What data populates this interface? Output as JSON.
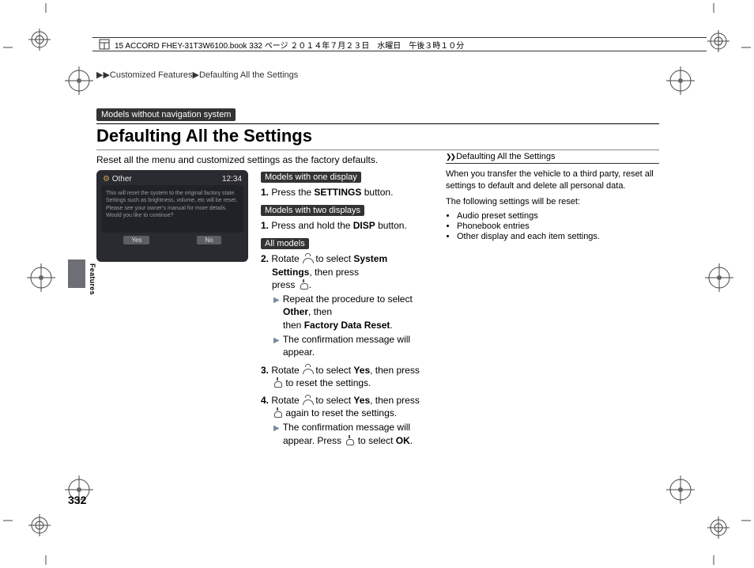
{
  "bookline": "15 ACCORD FHEY-31T3W6100.book  332 ページ  ２０１４年７月２３日　水曜日　午後３時１０分",
  "breadcrumb": {
    "part1": "Customized Features",
    "part2": "Defaulting All the Settings"
  },
  "section_tag": "Models without navigation system",
  "title": "Defaulting All the Settings",
  "intro": "Reset all the menu and customized settings as the factory defaults.",
  "screenshot": {
    "tab": "Other",
    "clock": "12:34",
    "msg": "This will reset the system to the original factory state. Settings such as brightness, volume, etc will be reset. Please see your owner's manual for more details. Would you like to continue?",
    "yes": "Yes",
    "no": "No"
  },
  "mid": {
    "tag_one": "Models with one display",
    "step1a_num": "1.",
    "step1a_a": "Press the ",
    "step1a_b": "SETTINGS",
    "step1a_c": " button.",
    "tag_two": "Models with two displays",
    "step1b_num": "1.",
    "step1b_a": "Press and hold the ",
    "step1b_b": "DISP",
    "step1b_c": " button.",
    "tag_all": "All models",
    "step2_num": "2.",
    "step2_a": "Rotate ",
    "step2_b": " to select ",
    "step2_c": "System Settings",
    "step2_d": ", then press ",
    "step2_e": ".",
    "step2_sub1_a": "Repeat the procedure to select ",
    "step2_sub1_b": "Other",
    "step2_sub1_c": ", then ",
    "step2_sub1_d": "Factory Data Reset",
    "step2_sub1_e": ".",
    "step2_sub2": "The confirmation message will appear.",
    "step3_num": "3.",
    "step3_a": "Rotate ",
    "step3_b": " to select ",
    "step3_c": "Yes",
    "step3_d": ", then press ",
    "step3_e": " to reset the settings.",
    "step4_num": "4.",
    "step4_a": "Rotate ",
    "step4_b": " to select ",
    "step4_c": "Yes",
    "step4_d": ", then press ",
    "step4_e": " again to reset the settings.",
    "step4_sub_a": "The confirmation message will appear. Press ",
    "step4_sub_b": " to select ",
    "step4_sub_c": "OK",
    "step4_sub_d": "."
  },
  "right": {
    "header": "Defaulting All the Settings",
    "p1": "When you transfer the vehicle to a third party, reset all settings to default and delete all personal data.",
    "p2": "The following settings will be reset:",
    "li1": "Audio preset settings",
    "li2": "Phonebook entries",
    "li3": "Other display and each item settings."
  },
  "page_number": "332",
  "side_label": "Features"
}
